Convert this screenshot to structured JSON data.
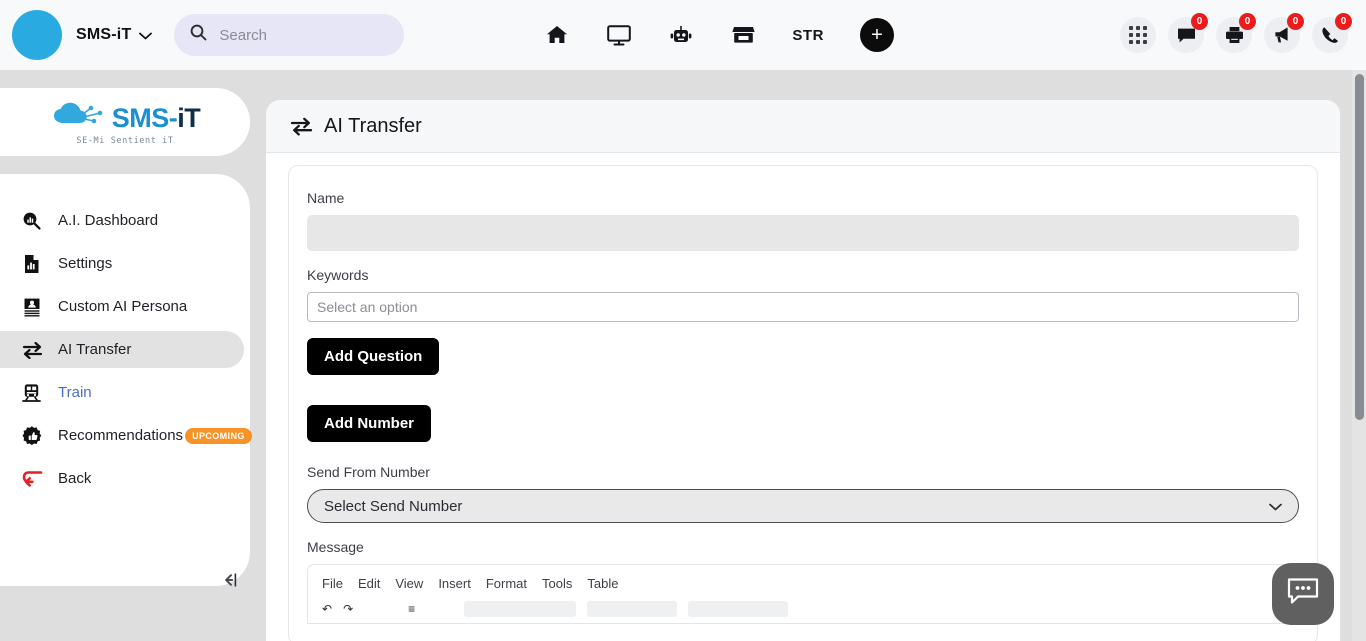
{
  "topbar": {
    "brand_name": "SMS-iT",
    "brand_caret": "⌄",
    "search": {
      "placeholder": "Search",
      "value": "",
      "icon": "search-icon"
    },
    "nav_items": [
      {
        "name": "home-icon",
        "label": ""
      },
      {
        "name": "monitor-icon",
        "label": ""
      },
      {
        "name": "robot-icon",
        "label": ""
      },
      {
        "name": "store-icon",
        "label": ""
      },
      {
        "name": "str-link",
        "label": "STR"
      }
    ],
    "add_button_label": "+",
    "right_icons": [
      {
        "name": "apps-grid-icon",
        "badge": ""
      },
      {
        "name": "chat-bubble-icon",
        "badge": "0"
      },
      {
        "name": "printer-icon",
        "badge": "0"
      },
      {
        "name": "megaphone-icon",
        "badge": "0"
      },
      {
        "name": "phone-icon",
        "badge": "0"
      }
    ],
    "badge_color": "#ef1b1b",
    "accent_color": "#29ABE2"
  },
  "sidebar": {
    "logo": {
      "text_main": "SMS-",
      "text_accent": "iT",
      "tagline": "SE-Mi Sentient iT"
    },
    "items": [
      {
        "label": "A.I. Dashboard",
        "icon": "dashboard-search-chart-icon",
        "state": "normal"
      },
      {
        "label": "Settings",
        "icon": "document-chart-icon",
        "state": "normal"
      },
      {
        "label": "Custom AI Persona",
        "icon": "id-card-icon",
        "state": "normal"
      },
      {
        "label": "AI Transfer",
        "icon": "transfer-arrows-icon",
        "state": "active"
      },
      {
        "label": "Train",
        "icon": "train-icon",
        "state": "link"
      },
      {
        "label": "Recommendations",
        "icon": "thumbs-up-badge-icon",
        "state": "normal",
        "badge": "UPCOMING"
      },
      {
        "label": "Back",
        "icon": "back-arrow-icon",
        "state": "normal"
      }
    ],
    "badge_color": "#f79226",
    "collapse_label": "←",
    "active_bg": "#e2e2e2",
    "link_color": "#4a6ed0"
  },
  "main": {
    "header": {
      "title": "AI Transfer",
      "icon": "transfer-arrows-icon"
    },
    "fields": {
      "name": {
        "label": "Name",
        "value": "",
        "disabled": true
      },
      "keywords": {
        "label": "Keywords",
        "placeholder": "Select an option",
        "value": ""
      },
      "send_from_number": {
        "label": "Send From Number",
        "value": "Select Send Number",
        "caret": "⌄"
      },
      "message": {
        "label": "Message"
      }
    },
    "buttons": {
      "add_question": "Add Question",
      "add_number": "Add Number"
    },
    "editor": {
      "menus": [
        "File",
        "Edit",
        "View",
        "Insert",
        "Format",
        "Tools",
        "Table"
      ],
      "toolbar_glyphs": [
        "↶",
        "↷",
        "≡"
      ]
    }
  },
  "chat_widget": {
    "icon": "chat-bubble-dots-icon"
  }
}
